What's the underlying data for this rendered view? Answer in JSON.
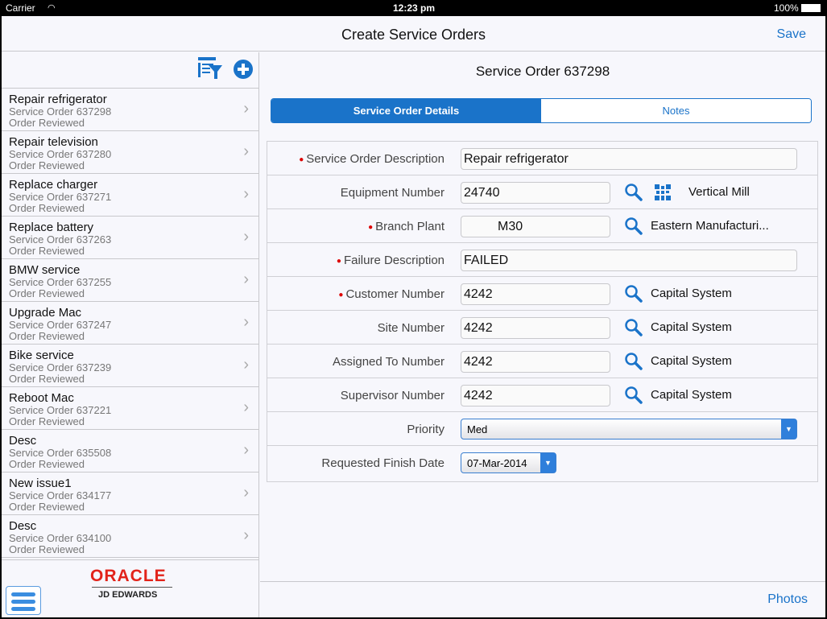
{
  "status": {
    "carrier": "Carrier",
    "time": "12:23 pm",
    "battery": "100%"
  },
  "header": {
    "title": "Create Service Orders",
    "save": "Save"
  },
  "list": [
    {
      "title": "Repair refrigerator",
      "sub": "Service Order 637298",
      "status": "Order Reviewed"
    },
    {
      "title": "Repair television",
      "sub": "Service Order 637280",
      "status": "Order Reviewed"
    },
    {
      "title": "Replace charger",
      "sub": "Service Order 637271",
      "status": "Order Reviewed"
    },
    {
      "title": "Replace battery",
      "sub": "Service Order 637263",
      "status": "Order Reviewed"
    },
    {
      "title": "BMW service",
      "sub": "Service Order 637255",
      "status": "Order Reviewed"
    },
    {
      "title": "Upgrade Mac",
      "sub": "Service Order 637247",
      "status": "Order Reviewed"
    },
    {
      "title": "Bike service",
      "sub": "Service Order 637239",
      "status": "Order Reviewed"
    },
    {
      "title": "Reboot Mac",
      "sub": "Service Order 637221",
      "status": "Order Reviewed"
    },
    {
      "title": "Desc",
      "sub": "Service Order 635508",
      "status": "Order Reviewed"
    },
    {
      "title": "New issue1",
      "sub": "Service Order 634177",
      "status": "Order Reviewed"
    },
    {
      "title": "Desc",
      "sub": "Service Order 634100",
      "status": "Order Reviewed"
    }
  ],
  "logo": {
    "brand": "ORACLE",
    "product": "JD EDWARDS"
  },
  "detail": {
    "title": "Service Order 637298",
    "tabs": [
      "Service Order Details",
      "Notes"
    ],
    "fields": {
      "description": {
        "label": "Service Order Description",
        "value": "Repair refrigerator"
      },
      "equipment": {
        "label": "Equipment Number",
        "value": "24740",
        "desc": "Vertical Mill"
      },
      "branch": {
        "label": "Branch Plant",
        "value": "M30",
        "desc": "Eastern Manufacturi..."
      },
      "failure": {
        "label": "Failure Description",
        "value": "FAILED"
      },
      "customer": {
        "label": "Customer Number",
        "value": "4242",
        "desc": "Capital System"
      },
      "site": {
        "label": "Site Number",
        "value": "4242",
        "desc": "Capital System"
      },
      "assigned": {
        "label": "Assigned To Number",
        "value": "4242",
        "desc": "Capital System"
      },
      "supervisor": {
        "label": "Supervisor Number",
        "value": "4242",
        "desc": "Capital System"
      },
      "priority": {
        "label": "Priority",
        "value": "Med"
      },
      "finish": {
        "label": "Requested Finish Date",
        "value": "07-Mar-2014"
      }
    }
  },
  "footer": {
    "photos": "Photos"
  },
  "colors": {
    "accent": "#1a73c9",
    "required": "#dd0000",
    "oracle": "#e2231a"
  }
}
